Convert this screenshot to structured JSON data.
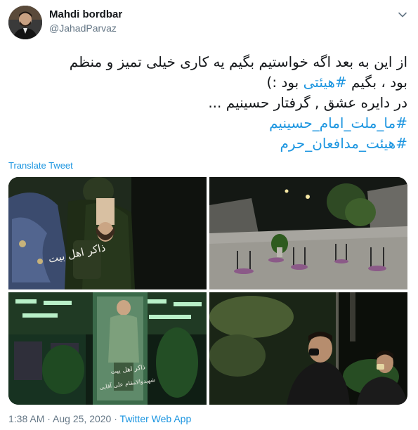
{
  "author": {
    "name": "Mahdi bordbar",
    "handle": "@JahadParvaz"
  },
  "tweet": {
    "line1": "از این به بعد اگه خواستیم بگیم یه کاری خیلی تمیز و منظم",
    "line2_before": "بود ، بگیم ",
    "line2_hashtag": "#هیئتی",
    "line2_after": " بود :)",
    "line3": "در دایره عشق , گرفتار حسینیم ...",
    "hashtag1": "#ما_ملت_امام_حسینیم",
    "hashtag2": "#هیئت_مدافعان_حرم"
  },
  "translate_label": "Translate Tweet",
  "photo_captions": {
    "top_left": "ذاکر اهل بیت",
    "bottom_left_1": "ذاکر اهل بیت",
    "bottom_left_2": "شهیدوالامقام علی آقایی"
  },
  "meta": {
    "time": "1:38 AM",
    "sep1": " · ",
    "date": "Aug 25, 2020",
    "sep2": " · ",
    "app": "Twitter Web App"
  },
  "icons": {
    "chevron": "chevron-down-icon"
  },
  "colors": {
    "link": "#1b95e0",
    "secondary": "#657786",
    "text": "#14171a"
  }
}
